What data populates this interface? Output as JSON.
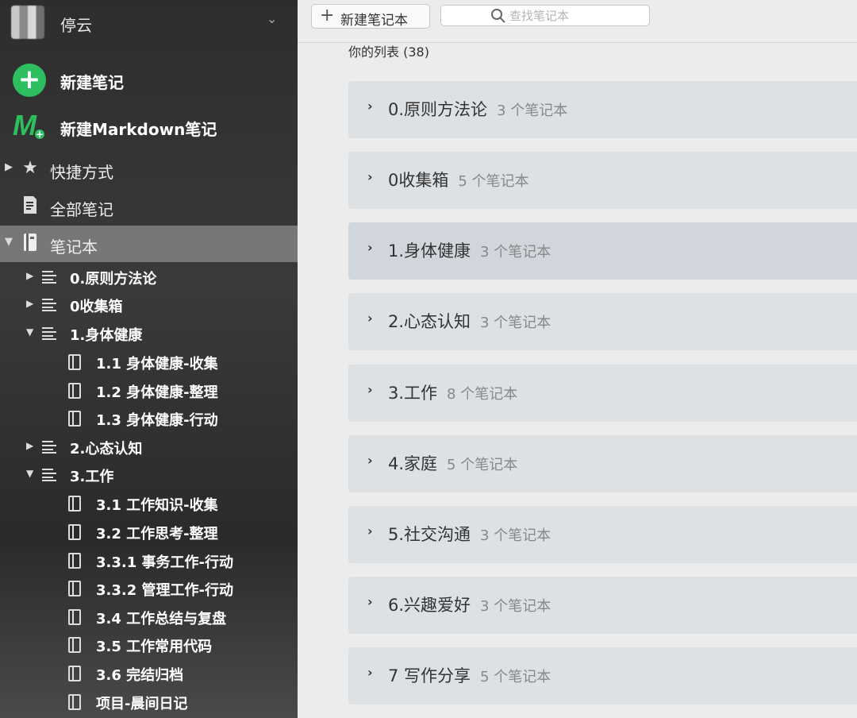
{
  "account": {
    "name": "停云"
  },
  "actions": {
    "new_note": "新建笔记",
    "new_markdown": "新建Markdown笔记",
    "markdown_logo": "M"
  },
  "nav": {
    "shortcuts": "快捷方式",
    "all_notes": "全部笔记",
    "notebooks": "笔记本"
  },
  "tree": {
    "stack0": "0.原则方法论",
    "stack1": "0收集箱",
    "stack2": "1.身体健康",
    "stack2_nb": [
      "1.1 身体健康-收集",
      "1.2 身体健康-整理",
      "1.3 身体健康-行动"
    ],
    "stack3": "2.心态认知",
    "stack4": "3.工作",
    "stack4_nb": [
      "3.1 工作知识-收集",
      "3.2 工作思考-整理",
      "3.3.1 事务工作-行动",
      "3.3.2 管理工作-行动",
      "3.4 工作总结与复盘",
      "3.5  工作常用代码",
      "3.6 完结归档",
      "项目-晨间日记"
    ]
  },
  "toolbar": {
    "new_notebook": "新建笔记本",
    "search_placeholder": "查找笔记本"
  },
  "list": {
    "title": "你的列表 (38)",
    "stacks": [
      {
        "name": "0.原则方法论",
        "count": "3 个笔记本"
      },
      {
        "name": "0收集箱",
        "count": "5 个笔记本"
      },
      {
        "name": "1.身体健康",
        "count": "3 个笔记本"
      },
      {
        "name": "2.心态认知",
        "count": "3 个笔记本"
      },
      {
        "name": "3.工作",
        "count": "8 个笔记本"
      },
      {
        "name": "4.家庭",
        "count": "5 个笔记本"
      },
      {
        "name": "5.社交沟通",
        "count": "3 个笔记本"
      },
      {
        "name": "6.兴趣爱好",
        "count": "3 个笔记本"
      },
      {
        "name": "7 写作分享",
        "count": "5 个笔记本"
      }
    ]
  },
  "colors": {
    "accent": "#2dbe60",
    "sidebar_bg": "#333333",
    "stack_bg": "#dde1e4"
  }
}
